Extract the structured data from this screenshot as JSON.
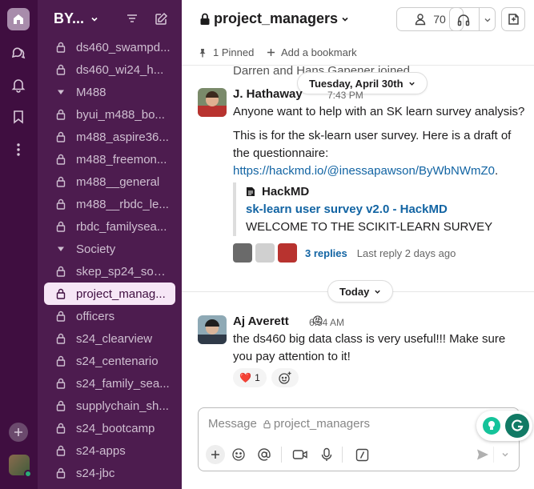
{
  "workspace": {
    "name": "BY..."
  },
  "sidebar": {
    "items": [
      {
        "type": "channel",
        "label": "ds460_swampd..."
      },
      {
        "type": "channel",
        "label": "ds460_wi24_h..."
      },
      {
        "type": "section",
        "label": "M488"
      },
      {
        "type": "channel",
        "label": "byui_m488_bo..."
      },
      {
        "type": "channel",
        "label": "m488_aspire36..."
      },
      {
        "type": "channel",
        "label": "m488_freemon..."
      },
      {
        "type": "channel",
        "label": "m488__general"
      },
      {
        "type": "channel",
        "label": "m488__rbdc_le..."
      },
      {
        "type": "channel",
        "label": "rbdc_familysea..."
      },
      {
        "type": "section",
        "label": "Society"
      },
      {
        "type": "channel",
        "label": "skep_sp24_soci..."
      },
      {
        "type": "channel",
        "label": "project_manag...",
        "active": true
      },
      {
        "type": "channel",
        "label": "officers"
      },
      {
        "type": "channel",
        "label": "s24_clearview"
      },
      {
        "type": "channel",
        "label": "s24_centenario"
      },
      {
        "type": "channel",
        "label": "s24_family_sea..."
      },
      {
        "type": "channel",
        "label": "supplychain_sh..."
      },
      {
        "type": "channel",
        "label": "s24_bootcamp"
      },
      {
        "type": "channel",
        "label": "s24-apps"
      },
      {
        "type": "channel",
        "label": "s24-jbc"
      }
    ]
  },
  "header": {
    "channel_name": "project_managers",
    "member_count": "70",
    "pinned_label": "1 Pinned",
    "bookmark_label": "Add a bookmark"
  },
  "messages": {
    "system_text": "Darren and Hans Gapener joined",
    "date_divider_1": "Tuesday, April 30th",
    "date_divider_2": "Today",
    "msg1": {
      "author": "J. Hathaway",
      "time": "7:43 PM",
      "line1": "Anyone want to help with an SK learn survey analysis?",
      "line2": "This is for the sk-learn user survey. Here is a draft of the questionnaire:",
      "link": "https://hackmd.io/@inessapawson/ByWbNWmZ0",
      "link_suffix": ".",
      "unfurl_source": "HackMD",
      "unfurl_title": "sk-learn user survey v2.0 - HackMD",
      "unfurl_desc": "WELCOME TO THE SCIKIT-LEARN SURVEY",
      "replies": "3 replies",
      "last_reply": "Last reply 2 days ago"
    },
    "msg2": {
      "author": "Aj Averett",
      "status_emoji": "😡",
      "time": "6:54 AM",
      "text": "the ds460 big data class is very useful!!! Make sure you pay attention to it!",
      "reaction_emoji": "❤️",
      "reaction_count": "1"
    }
  },
  "composer": {
    "placeholder_prefix": "Message",
    "placeholder_channel": "project_managers"
  },
  "colors": {
    "rail": "#3f0e40",
    "sidebar": "#4d1c4f",
    "active_item": "#f6e6f6",
    "link": "#1264a3",
    "grammarly": "#15c39a"
  }
}
